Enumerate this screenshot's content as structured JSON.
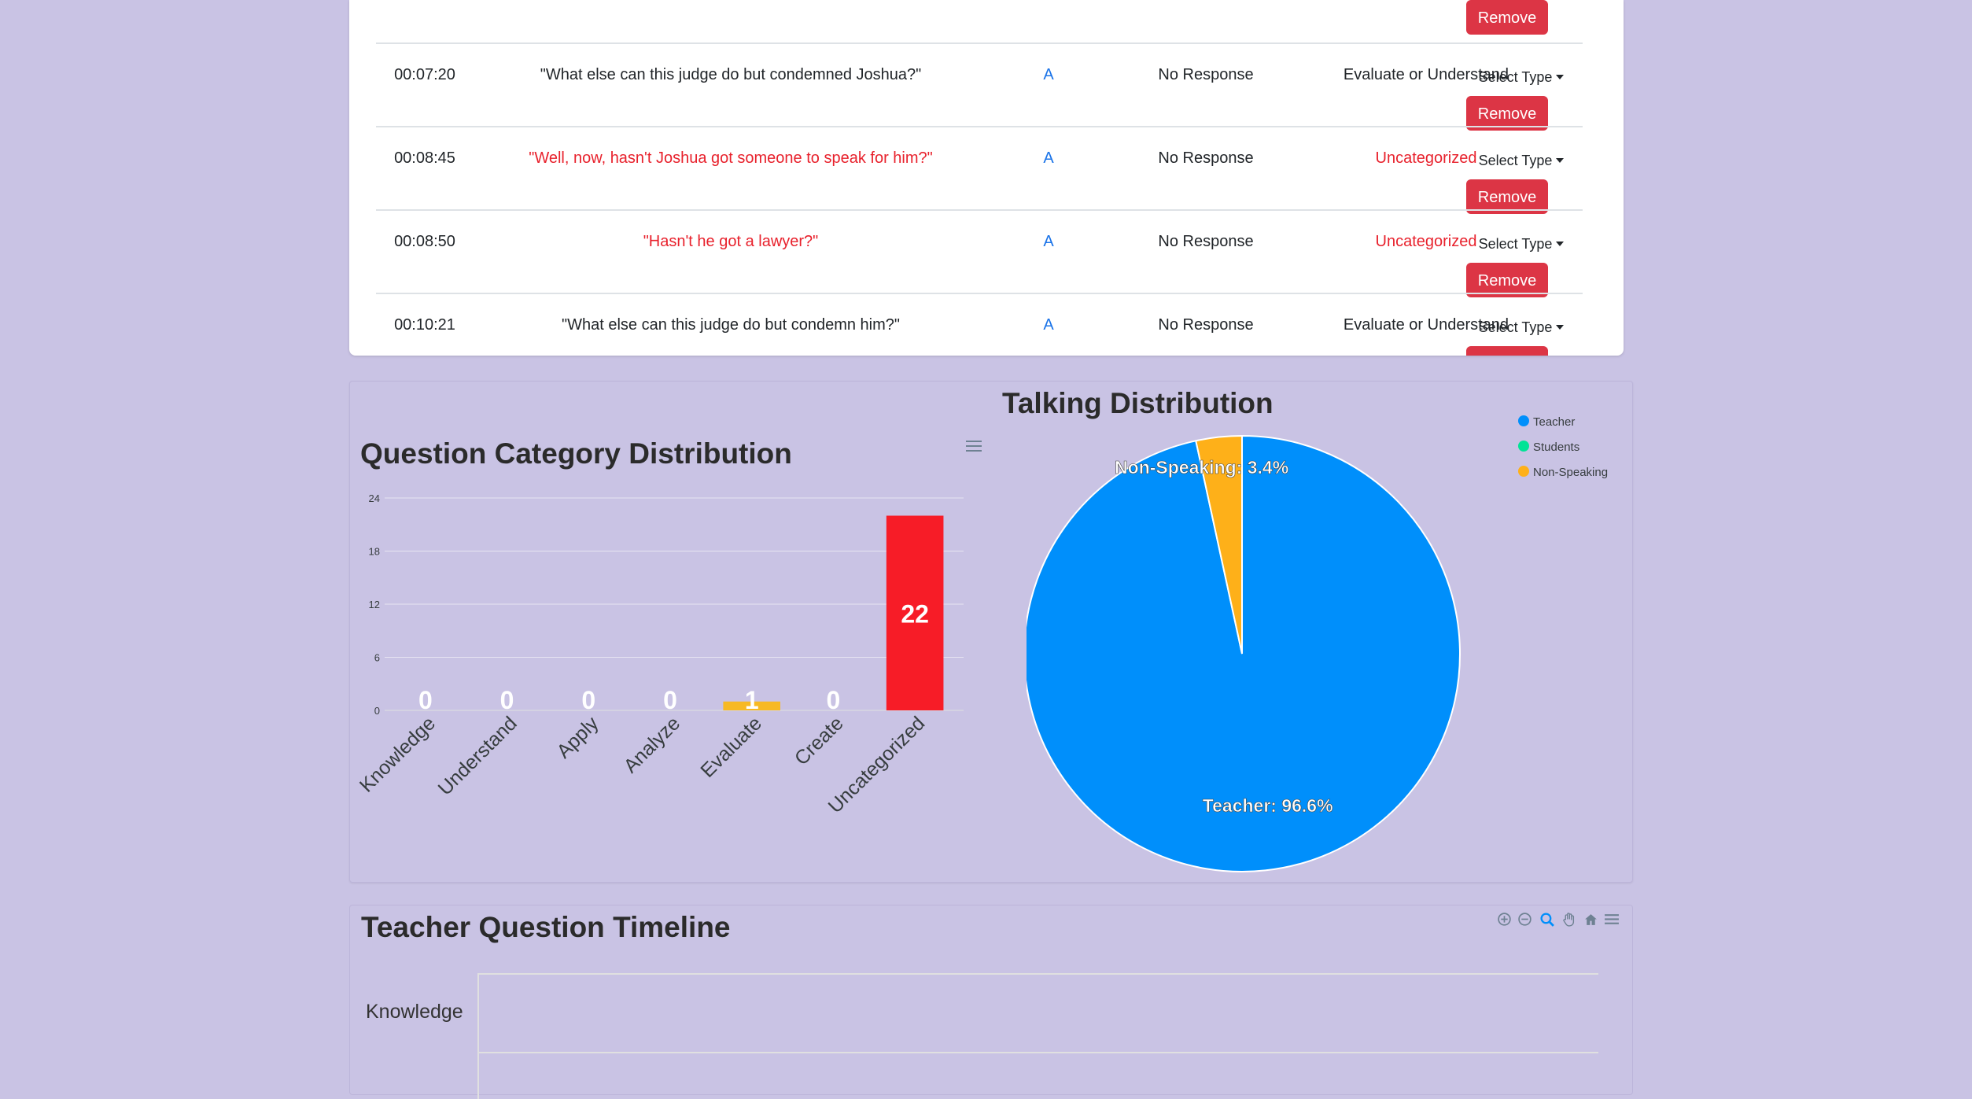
{
  "table": {
    "top_row": {
      "remove_label": "Remove"
    },
    "rows": [
      {
        "time": "00:07:20",
        "question": "\"What else can this judge do but condemned Joshua?\"",
        "speaker": "A",
        "response": "No Response",
        "category": "Evaluate or Understand",
        "select_label": "Select Type",
        "remove_label": "Remove",
        "highlight": false
      },
      {
        "time": "00:08:45",
        "question": "\"Well, now, hasn't Joshua got someone to speak for him?\"",
        "speaker": "A",
        "response": "No Response",
        "category": "Uncategorized",
        "select_label": "Select Type",
        "remove_label": "Remove",
        "highlight": true
      },
      {
        "time": "00:08:50",
        "question": "\"Hasn't he got a lawyer?\"",
        "speaker": "A",
        "response": "No Response",
        "category": "Uncategorized",
        "select_label": "Select Type",
        "remove_label": "Remove",
        "highlight": true
      },
      {
        "time": "00:10:21",
        "question": "\"What else can this judge do but condemn him?\"",
        "speaker": "A",
        "response": "No Response",
        "category": "Evaluate or Understand",
        "select_label": "Select Type",
        "remove_label": "Remove",
        "highlight": false
      }
    ]
  },
  "colors": {
    "remove_button": "#dc3545",
    "uncategorized_text": "#e8212c",
    "speaker_link": "#1a73e8",
    "page_background": "#c9c3e4"
  },
  "chart_data": [
    {
      "type": "bar",
      "title": "Question Category Distribution",
      "categories": [
        "Knowledge",
        "Understand",
        "Apply",
        "Analyze",
        "Evaluate",
        "Create",
        "Uncategorized"
      ],
      "values": [
        0,
        0,
        0,
        0,
        1,
        0,
        22
      ],
      "bar_colors": [
        "#2c8ef8",
        "#2c8ef8",
        "#2c8ef8",
        "#2c8ef8",
        "#f7b924",
        "#2c8ef8",
        "#f71c27"
      ],
      "yticks": [
        0,
        6,
        12,
        18,
        24
      ],
      "ylim": [
        0,
        24
      ],
      "data_labels": true,
      "grid": true,
      "menu_icon": "hamburger-icon"
    },
    {
      "type": "pie",
      "title": "Talking Distribution",
      "labels": [
        "Teacher",
        "Students",
        "Non-Speaking"
      ],
      "values": [
        96.6,
        0,
        3.4
      ],
      "colors": [
        "#008ffb",
        "#00e396",
        "#feb019"
      ],
      "data_labels": [
        "Teacher: 96.6%",
        "",
        "Non-Speaking: 3.4%"
      ],
      "legend_position": "top-right"
    }
  ],
  "timeline": {
    "title": "Teacher Question Timeline",
    "rows": [
      "Knowledge"
    ],
    "toolbar_icons": [
      "zoom-in-icon",
      "zoom-out-icon",
      "magnifier-icon",
      "pan-icon",
      "home-icon",
      "hamburger-icon"
    ]
  }
}
